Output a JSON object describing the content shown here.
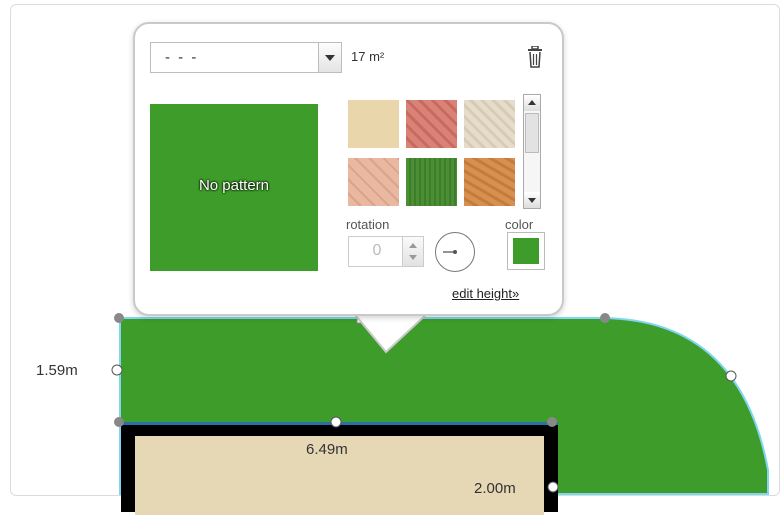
{
  "popup": {
    "pattern_select": {
      "value": "- - -"
    },
    "area": "17 m²",
    "preview_label": "No pattern",
    "swatches": [
      {
        "name": "beige-tile",
        "color": "#e9d6aa"
      },
      {
        "name": "red-brick",
        "color": "#d98277"
      },
      {
        "name": "cream-tile",
        "color": "#e7dccb"
      },
      {
        "name": "peach-tile",
        "color": "#e8b8a0"
      },
      {
        "name": "green-grass",
        "color": "#4b8f34"
      },
      {
        "name": "orange-wood",
        "color": "#d7904f"
      }
    ],
    "rotation_label": "rotation",
    "rotation_value": "0",
    "color_label": "color",
    "selected_color": "#3d9c2a",
    "edit_height_link": "edit height»"
  },
  "dimensions": {
    "left_height": "1.59m",
    "room_width": "6.49m",
    "room_height": "2.00m"
  },
  "colors": {
    "grass": "#3d9c2a",
    "room_floor": "#e6d7b5",
    "outline": "#7fd6ee"
  }
}
